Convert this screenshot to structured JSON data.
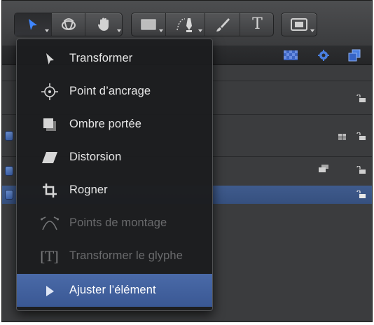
{
  "toolbar": {
    "groups": [
      {
        "name": "select-tools",
        "tools": [
          "select-arrow",
          "3d-transform",
          "pan-hand"
        ]
      },
      {
        "name": "shape-tools",
        "tools": [
          "rectangle",
          "bezier-pen",
          "paint-stroke",
          "text"
        ]
      },
      {
        "name": "mask-tools",
        "tools": [
          "mask-rectangle"
        ]
      }
    ],
    "text_tool_glyph": "T"
  },
  "menu": {
    "items": [
      {
        "label": "Transformer",
        "icon": "arrow-pointer-icon",
        "state": "normal"
      },
      {
        "label": "Point d’ancrage",
        "icon": "anchor-point-icon",
        "state": "normal"
      },
      {
        "label": "Ombre portée",
        "icon": "drop-shadow-icon",
        "state": "normal"
      },
      {
        "label": "Distorsion",
        "icon": "distort-icon",
        "state": "normal"
      },
      {
        "label": "Rogner",
        "icon": "crop-icon",
        "state": "normal"
      },
      {
        "label": "Points de montage",
        "icon": "edit-points-icon",
        "state": "disabled"
      },
      {
        "label": "Transformer le glyphe",
        "icon": "glyph-transform-icon",
        "state": "disabled"
      },
      {
        "label": "Ajuster l’élément",
        "icon": "adjust-item-icon",
        "state": "highlighted"
      }
    ],
    "glyph_icon_text": "[T]"
  },
  "colors": {
    "menu_bg": "#1c1d1f",
    "highlight": "#3f5f9e",
    "selected_row": "#3a5586",
    "text": "#e6e6e6",
    "disabled_text": "#6a6b6d"
  }
}
